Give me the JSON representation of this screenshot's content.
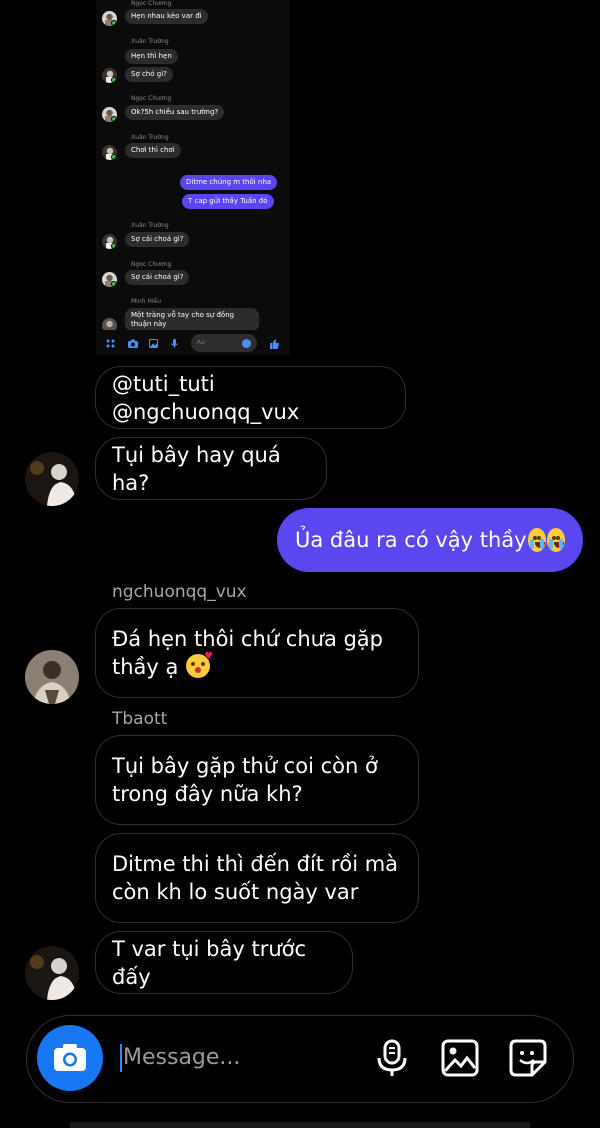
{
  "embedded_screenshot": {
    "messages": [
      {
        "sender": "Ngọc Chương",
        "text": "Hẹn nhau kèo var đi"
      },
      {
        "sender": "Xuân Trường",
        "texts": [
          "Hẹn thì hẹn",
          "Sợ chó gì?"
        ]
      },
      {
        "sender": "Ngọc Chương",
        "text": "Ok?5h chiều sau trường?"
      },
      {
        "sender": "Xuân Trường",
        "text": "Chơi thì chơi"
      },
      {
        "sender": "me",
        "texts": [
          "Ditme chúng m thôi nha",
          "T cap gửi thầy Tuấn đó"
        ]
      },
      {
        "sender": "Xuân Trường",
        "text": "Sợ cái choá gì?"
      },
      {
        "sender": "Ngọc Chương",
        "text": "Sợ cái choá gì?"
      },
      {
        "sender": "Minh Hiếu",
        "text": "Một tràng vỗ tay cho sự đồng thuận này"
      }
    ],
    "composer_placeholder": "Aa"
  },
  "messages": [
    {
      "text": "@tuti_tuti @ngchuonqq_vux"
    },
    {
      "text": "Tụi bây hay quá ha?"
    },
    {
      "text": "Ủa đâu ra có vậy thầy",
      "emoji": "loudly-crying-face x2"
    },
    {
      "sender": "ngchuonqq_vux",
      "text": "Đá hẹn thôi chứ chưa gặp thầy ạ",
      "emoji": "face-blowing-kiss"
    },
    {
      "sender": "Tbaott",
      "text": "Tụi bây gặp thử coi còn ở trong đây nữa kh?"
    },
    {
      "text": "Ditme thi thì đến đít rồi mà còn kh lo suốt ngày var"
    },
    {
      "text": "T var tụi bây trước đấy"
    }
  ],
  "composer": {
    "placeholder": "Message...",
    "icons": [
      "camera-icon",
      "microphone-icon",
      "gallery-icon",
      "sticker-icon"
    ]
  },
  "colors": {
    "background": "#000000",
    "sent_bubble": "#5b47ef",
    "camera_button": "#1877f2",
    "received_bubble_border": "#2f2f2f"
  }
}
